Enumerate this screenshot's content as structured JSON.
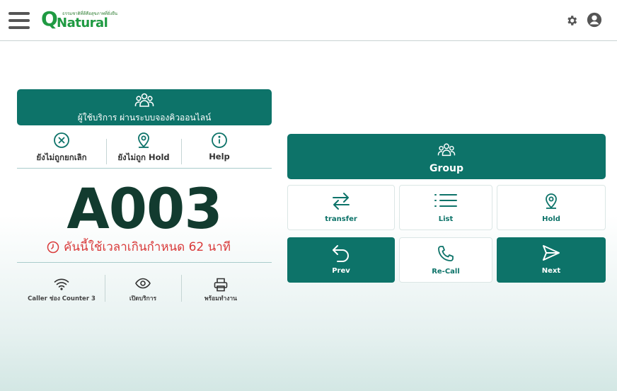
{
  "header": {
    "logo_letter": "Q",
    "logo_word": "Natural",
    "logo_tagline": "ธรรมชาติที่ดีคือสุขภาพที่ยั่งยืน"
  },
  "service_banner": {
    "label": "ผู้ใช้บริการ ผ่านระบบจองคิวออนไลน์"
  },
  "status_items": [
    {
      "label": "ยังไม่ถูกยกเลิก",
      "icon": "cancel-circle-icon"
    },
    {
      "label": "ยังไม่ถูก Hold",
      "icon": "location-pin-icon"
    },
    {
      "label": "Help",
      "icon": "info-icon"
    }
  ],
  "queue": {
    "number": "A003",
    "overtime_text": "คันนี้ใช้เวลาเกินกำหนด 62 นาที"
  },
  "footer_items": [
    {
      "label": "Caller ช่อง Counter 3",
      "icon": "wifi-icon"
    },
    {
      "label": "เปิดบริการ",
      "icon": "eye-icon"
    },
    {
      "label": "พร้อมทำงาน",
      "icon": "printer-icon"
    }
  ],
  "actions": {
    "group": "Group",
    "transfer": "transfer",
    "list": "List",
    "hold": "Hold",
    "prev": "Prev",
    "recall": "Re-Call",
    "next": "Next"
  },
  "colors": {
    "primary": "#0d7369",
    "alert": "#d93a3a",
    "queue_text": "#123b2f",
    "logo_green": "#1f9a42"
  }
}
